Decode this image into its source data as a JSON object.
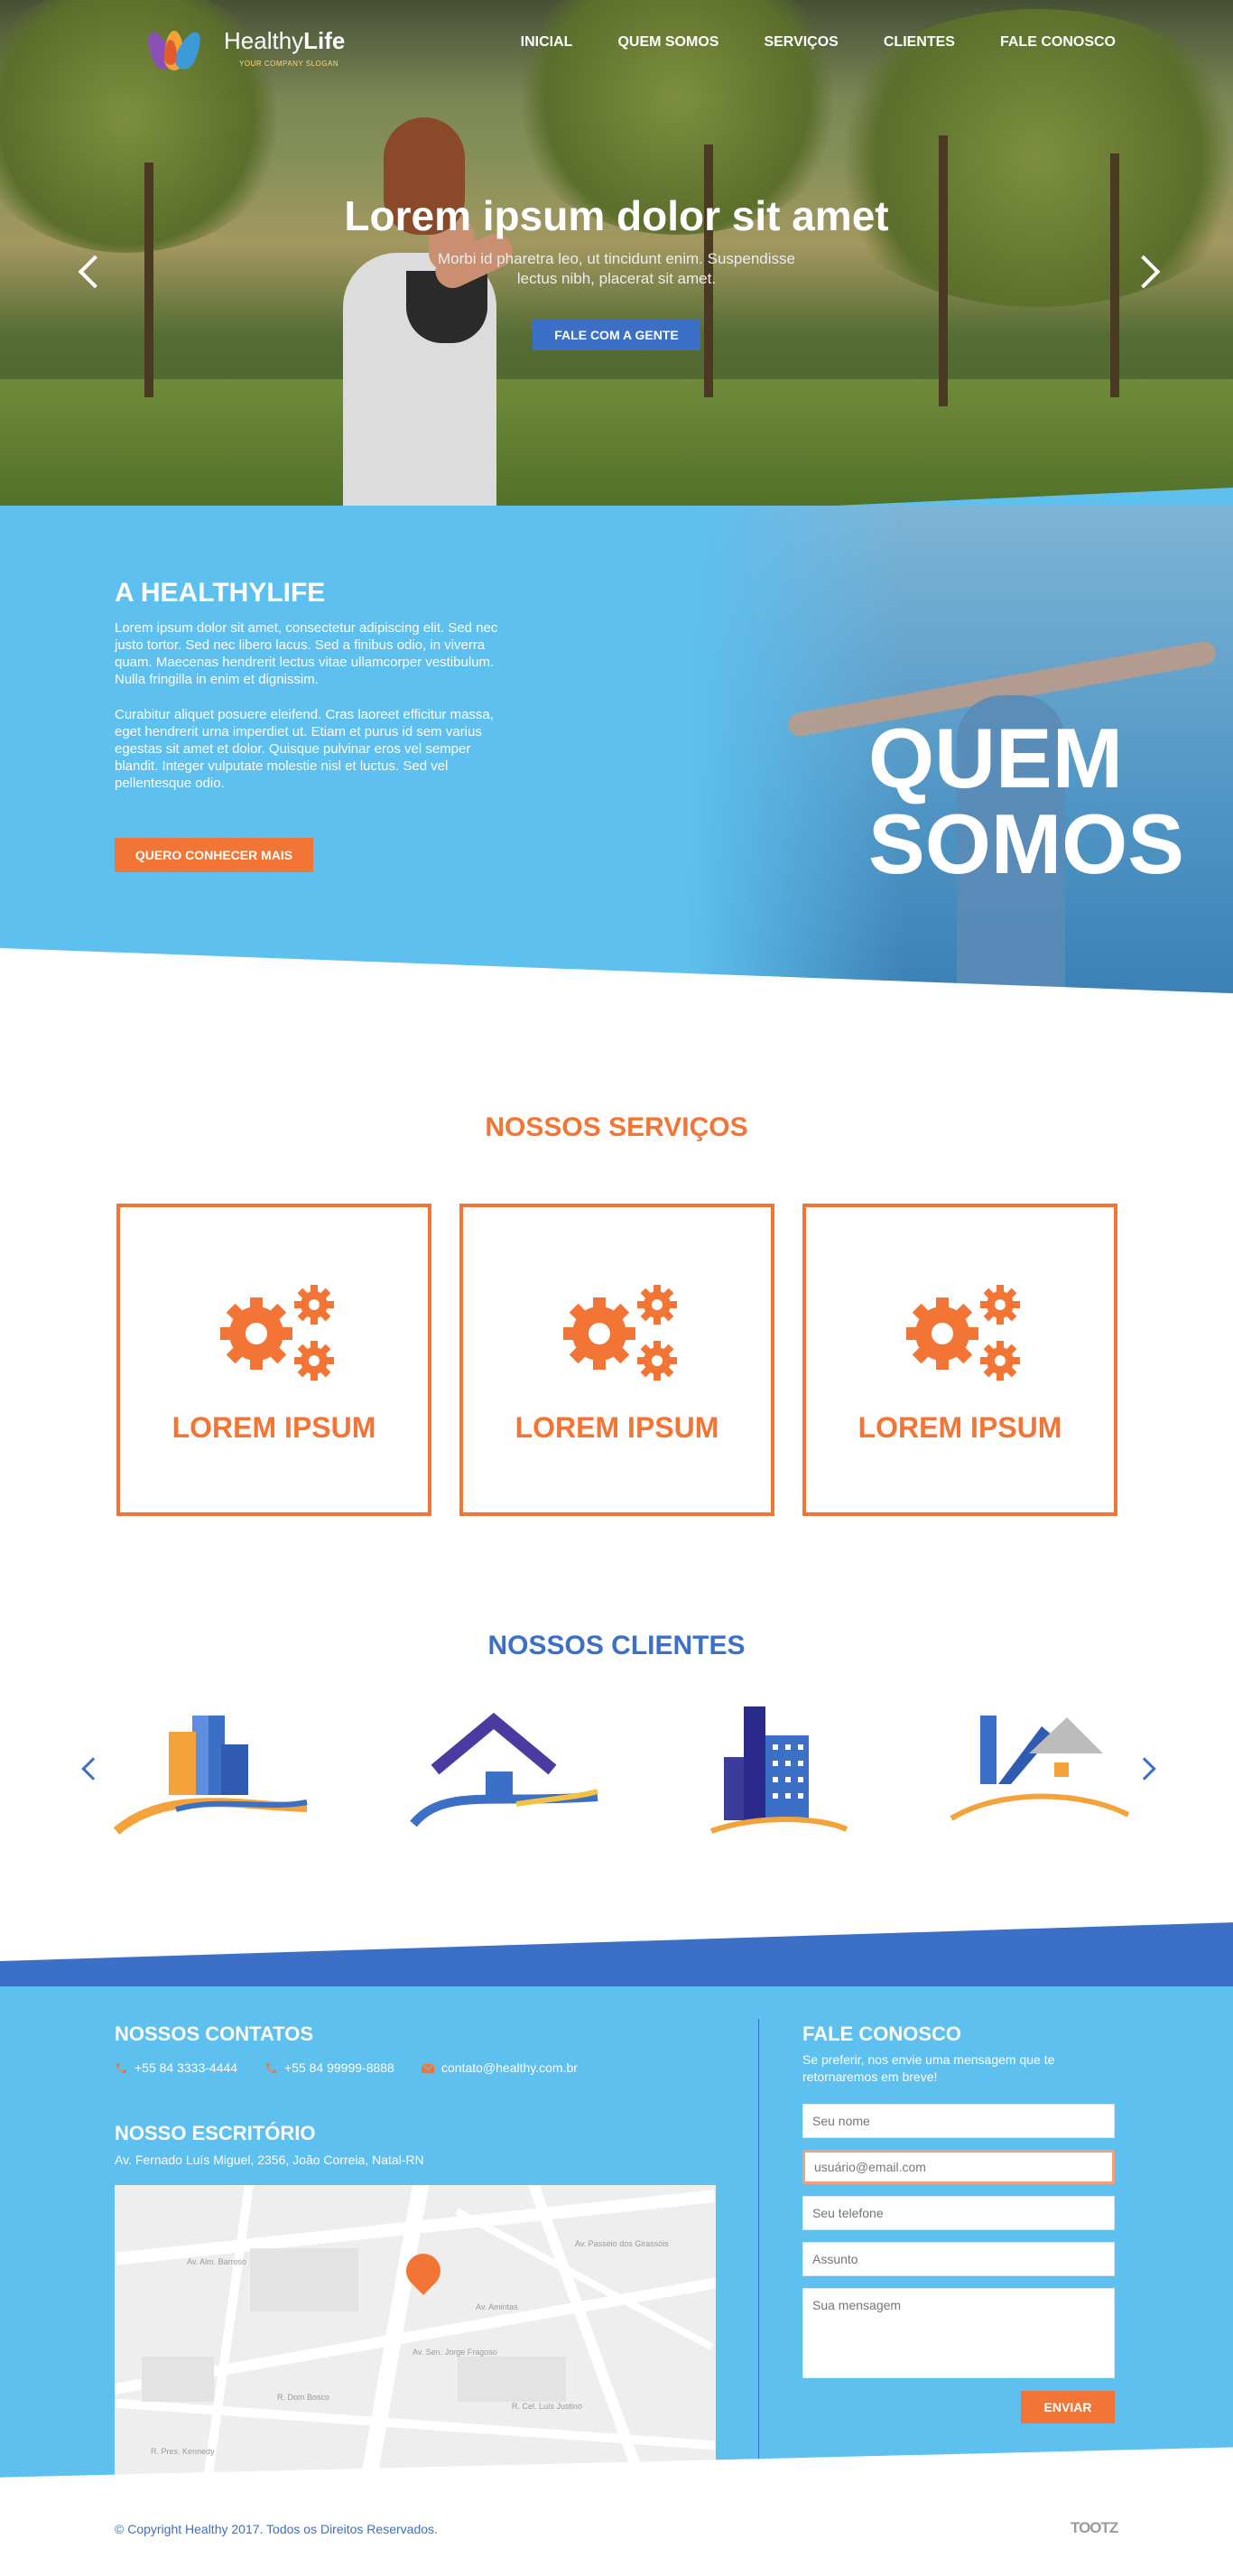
{
  "header": {
    "logo_name_light": "Healthy",
    "logo_name_bold": "Life",
    "logo_slogan": "YOUR COMPANY SLOGAN",
    "nav": [
      "INICIAL",
      "QUEM SOMOS",
      "SERVIÇOS",
      "CLIENTES",
      "FALE CONOSCO"
    ]
  },
  "hero": {
    "title": "Lorem ipsum dolor sit amet",
    "subtitle": "Morbi id pharetra leo, ut tincidunt enim. Suspendisse lectus nibh, placerat sit amet.",
    "cta": "FALE COM A GENTE"
  },
  "about": {
    "title": "A HEALTHYLIFE",
    "paragraph1": "Lorem ipsum dolor sit amet, consectetur adipiscing elit. Sed nec justo tortor. Sed nec libero lacus. Sed a finibus odio, in viverra quam. Maecenas hendrerit lectus vitae ullamcorper vestibulum. Nulla fringilla in enim et dignissim.",
    "paragraph2": "Curabitur aliquet posuere eleifend. Cras laoreet efficitur massa, eget hendrerit urna imperdiet ut. Etiam et purus id sem varius egestas sit amet et dolor. Quisque pulvinar eros vel semper blandit. Integer vulputate molestie nisl et luctus. Sed vel pellentesque odio.",
    "cta": "QUERO CONHECER MAIS",
    "big_line1": "QUEM",
    "big_line2": "SOMOS"
  },
  "services": {
    "title": "NOSSOS SERVIÇOS",
    "cards": [
      {
        "label": "LOREM IPSUM",
        "icon": "gears-icon"
      },
      {
        "label": "LOREM IPSUM",
        "icon": "gears-icon"
      },
      {
        "label": "LOREM IPSUM",
        "icon": "gears-icon"
      }
    ]
  },
  "clients": {
    "title": "NOSSOS CLIENTES",
    "logos": [
      "buildings-wave-logo",
      "house-wave-logo",
      "city-towers-logo",
      "roof-house-logo"
    ]
  },
  "contact": {
    "title": "NOSSOS CONTATOS",
    "phone1": "+55 84 3333-4444",
    "phone2": "+55 84 99999-8888",
    "email": "contato@healthy.com.br",
    "office_title": "NOSSO ESCRITÓRIO",
    "address": "Av. Fernado Luís Miguel, 2356, João Correia, Natal-RN",
    "map_labels": [
      "Av. Alm. Barroso",
      "Av. Passeio dos Girassóis",
      "Av. Amintas",
      "R. Cel. Luís Justino",
      "R. Dom Bosco",
      "Av. Sen. Jorge Fragoso",
      "R. Pres. Kennedy"
    ]
  },
  "form": {
    "title": "FALE CONOSCO",
    "subtitle": "Se preferir, nos envie uma mensagem que te retornaremos em breve!",
    "name_placeholder": "Seu nome",
    "email_value": "usuário@email.com",
    "phone_placeholder": "Seu telefone",
    "subject_placeholder": "Assunto",
    "message_placeholder": "Sua mensagem",
    "send": "ENVIAR"
  },
  "footer": {
    "copyright": "© Copyright Healthy 2017. Todos os Direitos Reservados.",
    "brand": "TOOTZ"
  },
  "colors": {
    "orange": "#f37535",
    "sky": "#5ec0ef",
    "blue": "#3c6fc6"
  }
}
